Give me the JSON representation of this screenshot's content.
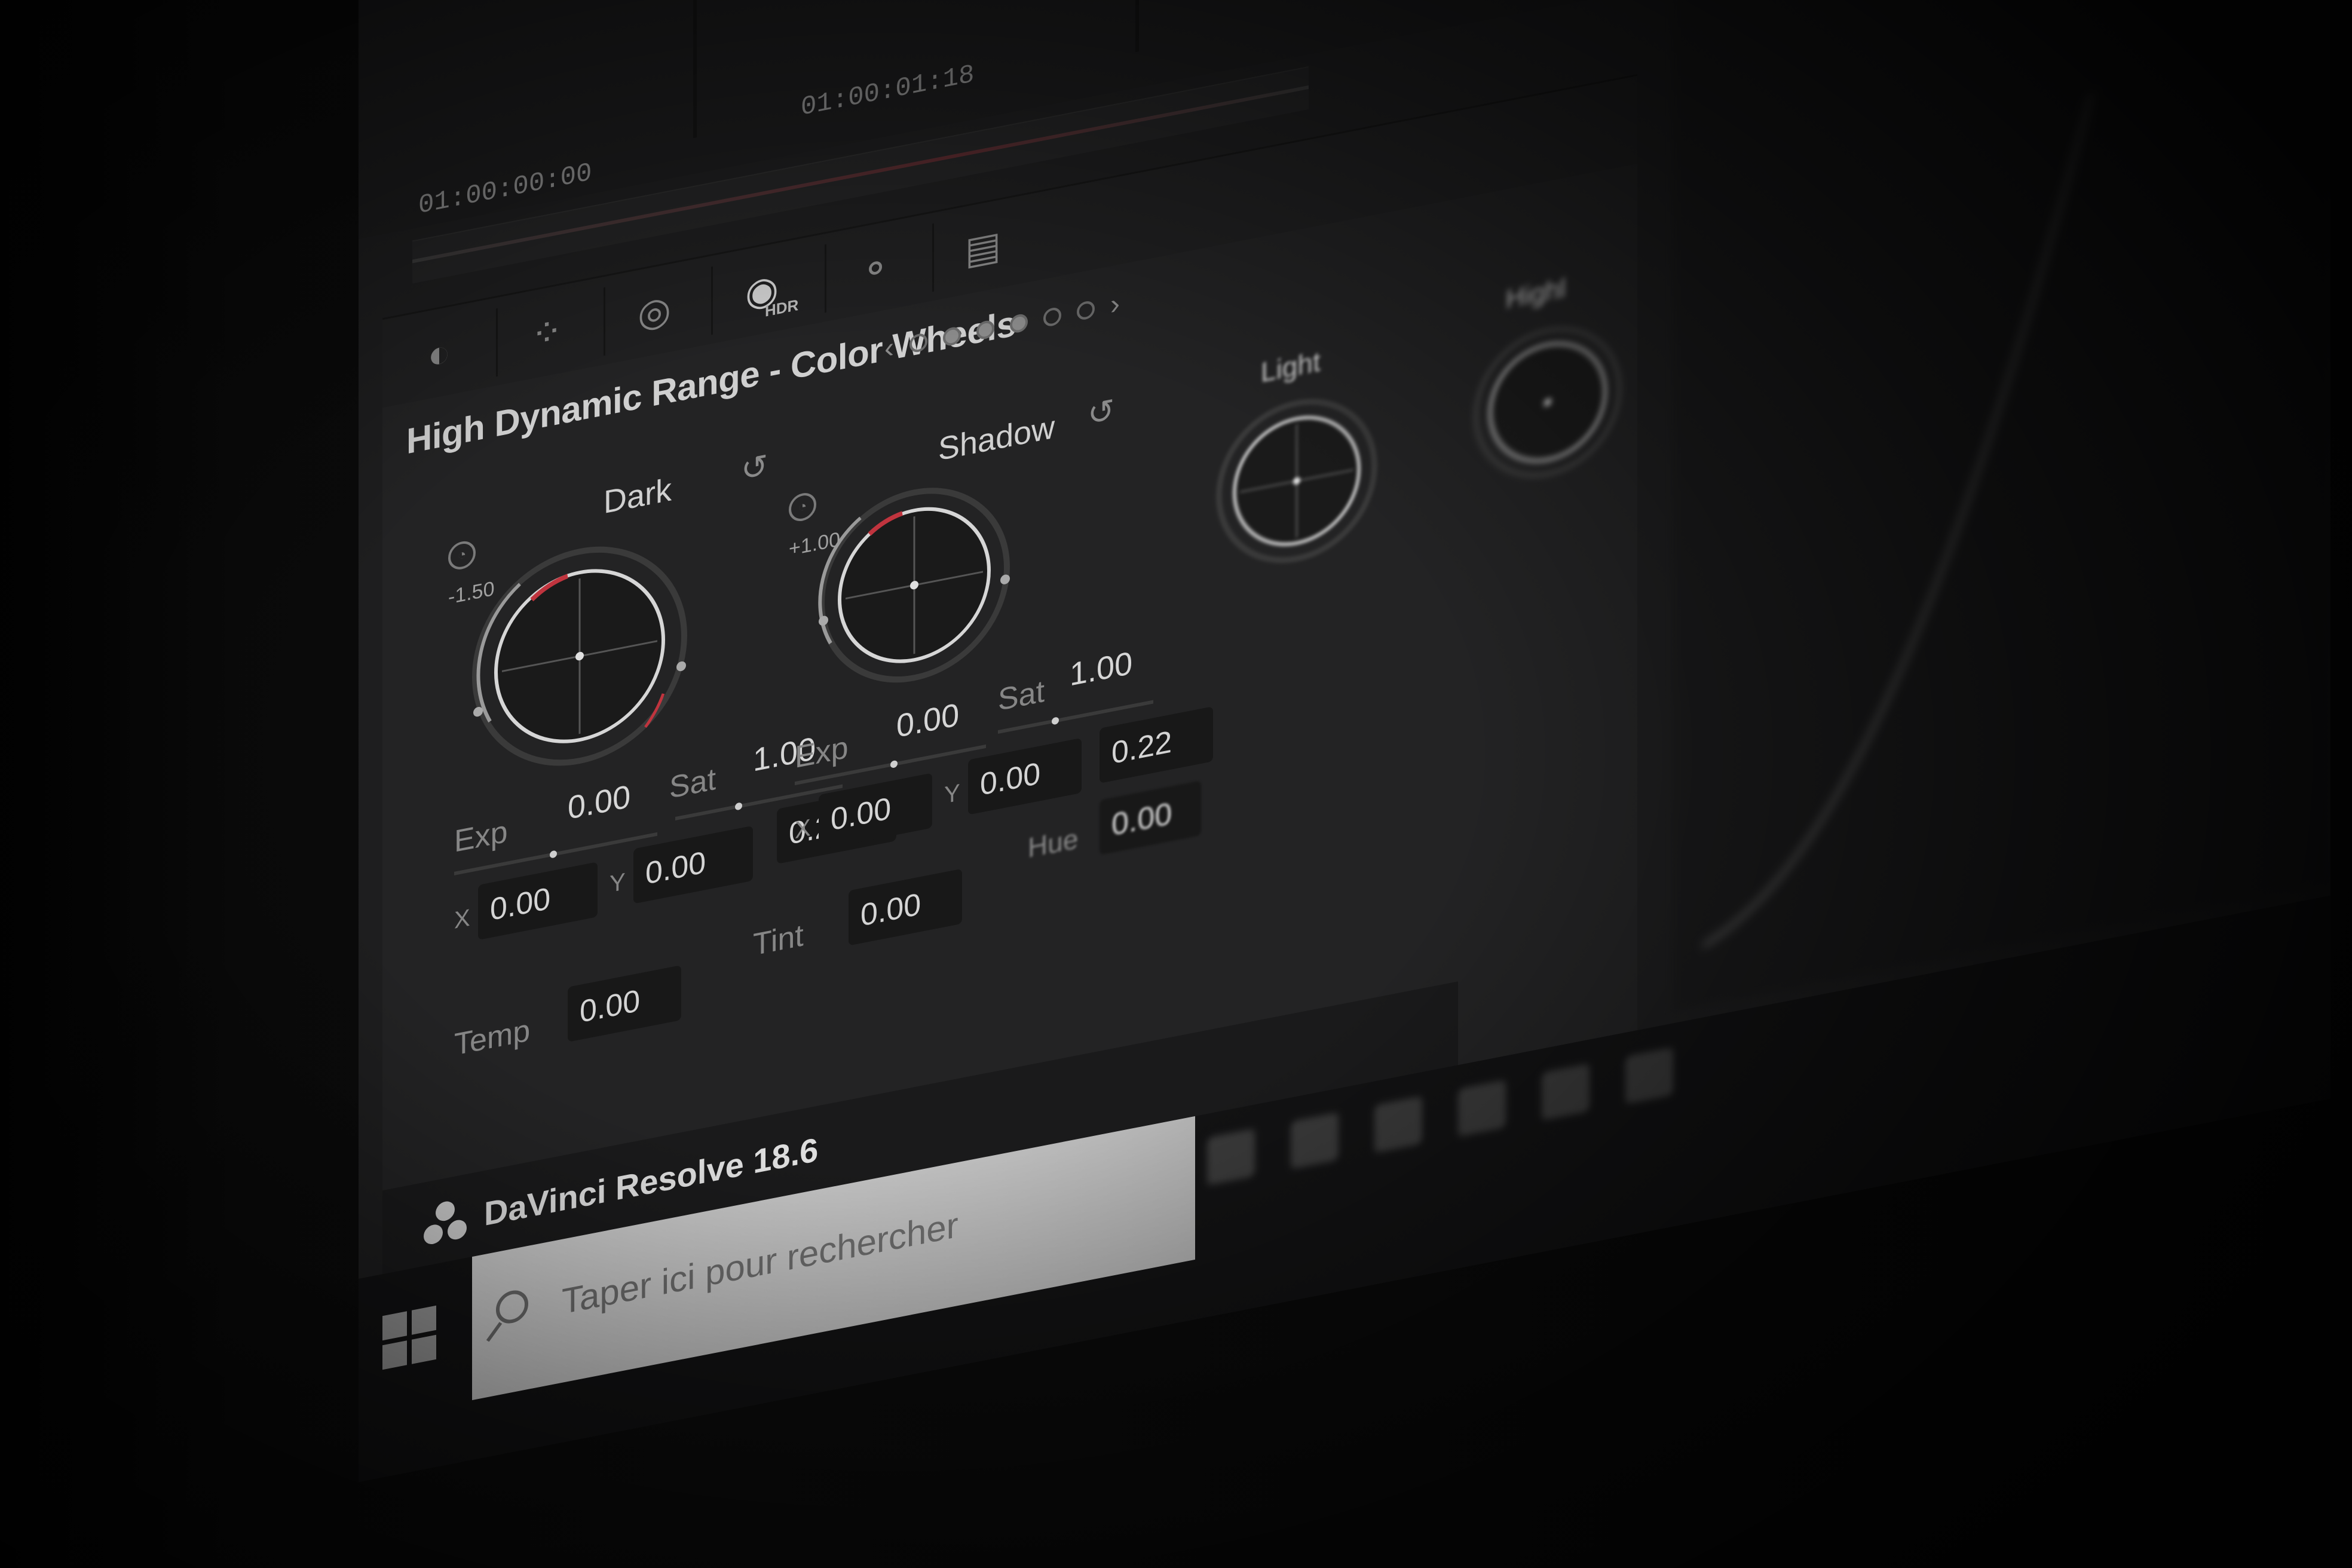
{
  "app": {
    "title": "DaVinci Resolve 18.6"
  },
  "viewer": {
    "timecode_left": "01:00:00:00",
    "timecode_right": "01:00:01:18"
  },
  "toolbar": {
    "hdr_badge": "HDR"
  },
  "panel": {
    "title": "High Dynamic Range - Color Wheels",
    "pager_count": 6,
    "pager_active": 3
  },
  "wheels": {
    "dark": {
      "label": "Dark",
      "zone_value": "-1.50",
      "exp_label": "Exp",
      "exp_value": "0.00",
      "sat_label": "Sat",
      "sat_value": "1.00",
      "x_label": "X",
      "x_value": "0.00",
      "y_label": "Y",
      "y_value": "0.00",
      "lum_value": "0.20"
    },
    "shadow": {
      "label": "Shadow",
      "zone_value": "+1.00",
      "exp_label": "Exp",
      "exp_value": "0.00",
      "sat_label": "Sat",
      "sat_value": "1.00",
      "x_label": "X",
      "x_value": "0.00",
      "y_label": "Y",
      "y_value": "0.00",
      "lum_value": "0.22"
    },
    "light": {
      "label": "Light"
    },
    "highlight": {
      "label": "Highl"
    }
  },
  "global": {
    "temp_label": "Temp",
    "temp_value": "0.00",
    "tint_label": "Tint",
    "tint_value": "0.00",
    "hue_label": "Hue",
    "hue_value": "0.00"
  },
  "taskbar": {
    "search_placeholder": "Taper ici pour rechercher"
  },
  "colors": {
    "accent_red": "#c0343e",
    "panel_bg": "#232324"
  }
}
